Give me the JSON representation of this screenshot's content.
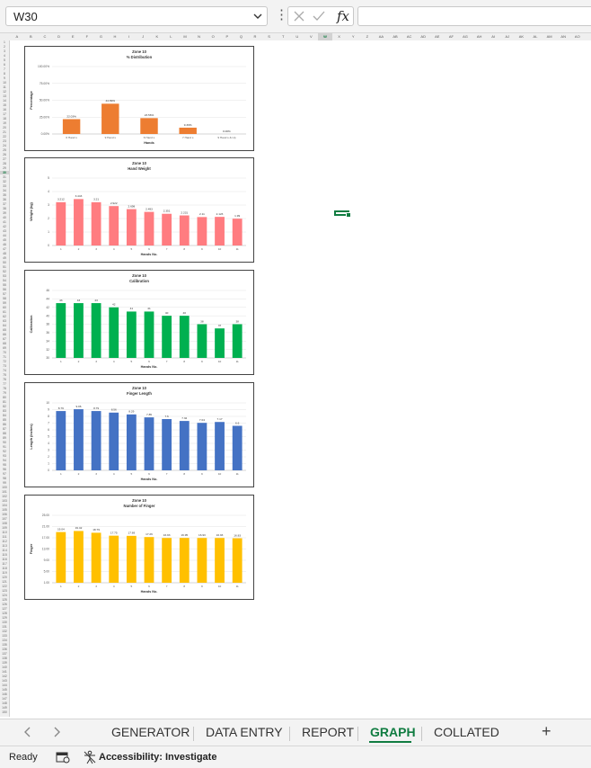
{
  "formula_bar": {
    "name_box": "W30",
    "fx_label": "fx",
    "formula_value": ""
  },
  "columns": [
    "A",
    "B",
    "C",
    "D",
    "E",
    "F",
    "G",
    "H",
    "I",
    "J",
    "K",
    "L",
    "M",
    "N",
    "O",
    "P",
    "Q",
    "R",
    "S",
    "T",
    "U",
    "V",
    "W",
    "X",
    "Y",
    "Z",
    "AA",
    "AB",
    "AC",
    "AD",
    "AE",
    "AF",
    "AG",
    "AH",
    "AI",
    "AJ",
    "AK",
    "AL",
    "AM",
    "AN",
    "AO"
  ],
  "rows_count": 150,
  "charts": [
    {
      "title": "Zone 10",
      "subtitle": "% Distribution",
      "xlabel": "Hands",
      "ylabel": "Percentage",
      "color": "#ed7d31",
      "y_ticks": [
        "0.00%",
        "25.00%",
        "50.00%",
        "75.00%",
        "100.00%"
      ],
      "ylim": [
        0,
        100
      ],
      "categories": [
        "6 Hand s",
        "9 Hand s",
        "6 Hand s",
        "7 Hand s",
        "9 Hand s & Up"
      ],
      "values": [
        22.03,
        44.89,
        23.56,
        9.39,
        0.0
      ],
      "value_labels": [
        "22.03%",
        "44.89%",
        "23.56%",
        "9.39%",
        "0.00%"
      ]
    },
    {
      "title": "Zone 10",
      "subtitle": "Hand Weight",
      "xlabel": "Hands No.",
      "ylabel": "Weight (kg)",
      "color": "#ff7c80",
      "y_ticks": [
        "0",
        "1",
        "2",
        "3",
        "4",
        "5"
      ],
      "ylim": [
        0,
        5
      ],
      "categories": [
        "1",
        "2",
        "3",
        "4",
        "5",
        "6",
        "7",
        "8",
        "9",
        "10",
        "11"
      ],
      "values": [
        3.212,
        3.443,
        3.21,
        2.922,
        2.698,
        2.493,
        2.351,
        2.231,
        2.11,
        2.123,
        1.99
      ],
      "value_labels": [
        "3.212",
        "3.443",
        "3.21",
        "2.922",
        "2.698",
        "2.493",
        "2.351",
        "2.231",
        "2.11",
        "2.123",
        "1.99"
      ]
    },
    {
      "title": "Zone 10",
      "subtitle": "Calibration",
      "xlabel": "Hands No.",
      "ylabel": "Calibration",
      "color": "#00b050",
      "y_ticks": [
        "30",
        "32",
        "34",
        "36",
        "38",
        "40",
        "42",
        "44",
        "46"
      ],
      "ylim": [
        30,
        46
      ],
      "categories": [
        "1",
        "2",
        "3",
        "4",
        "5",
        "6",
        "7",
        "8",
        "9",
        "10",
        "11"
      ],
      "values": [
        43,
        43,
        43,
        42,
        41,
        41,
        40,
        40,
        38,
        37,
        38
      ],
      "value_labels": [
        "43",
        "43",
        "43",
        "42",
        "41",
        "41",
        "40",
        "40",
        "38",
        "37",
        "38"
      ]
    },
    {
      "title": "Zone 10",
      "subtitle": "Finger Length",
      "xlabel": "Hands No.",
      "ylabel": "Length (inches)",
      "color": "#4472c4",
      "y_ticks": [
        "0",
        "1",
        "2",
        "3",
        "4",
        "5",
        "6",
        "7",
        "8",
        "9",
        "10"
      ],
      "ylim": [
        0,
        10
      ],
      "categories": [
        "1",
        "2",
        "3",
        "4",
        "5",
        "6",
        "7",
        "8",
        "9",
        "10",
        "11"
      ],
      "values": [
        8.79,
        9.06,
        8.79,
        8.56,
        8.29,
        7.85,
        7.6,
        7.32,
        7.04,
        7.17,
        6.6
      ],
      "value_labels": [
        "8.79",
        "9.06",
        "8.79",
        "8.56",
        "8.29",
        "7.85",
        "7.6",
        "7.32",
        "7.04",
        "7.17",
        "6.6"
      ]
    },
    {
      "title": "Zone 10",
      "subtitle": "Number of Finger",
      "xlabel": "Hands No.",
      "ylabel": "Finger",
      "color": "#ffc000",
      "y_ticks": [
        "1.00",
        "5.00",
        "9.00",
        "13.00",
        "17.00",
        "21.00",
        "25.00"
      ],
      "ylim": [
        1,
        25
      ],
      "categories": [
        "1",
        "2",
        "3",
        "4",
        "5",
        "6",
        "7",
        "8",
        "9",
        "10",
        "11"
      ],
      "values": [
        19.04,
        19.42,
        18.79,
        17.75,
        17.69,
        17.26,
        16.93,
        16.95,
        16.93,
        16.93,
        16.83
      ],
      "value_labels": [
        "19.04",
        "19.42",
        "18.79",
        "17.75",
        "17.69",
        "17.26",
        "16.93",
        "16.95",
        "16.93",
        "16.93",
        "16.83"
      ]
    }
  ],
  "sheet_tabs": [
    "GENERATOR",
    "DATA ENTRY",
    "REPORT",
    "GRAPH",
    "COLLATED"
  ],
  "active_tab": "GRAPH",
  "add_sheet_label": "+",
  "status": {
    "ready": "Ready",
    "accessibility": "Accessibility: Investigate"
  }
}
